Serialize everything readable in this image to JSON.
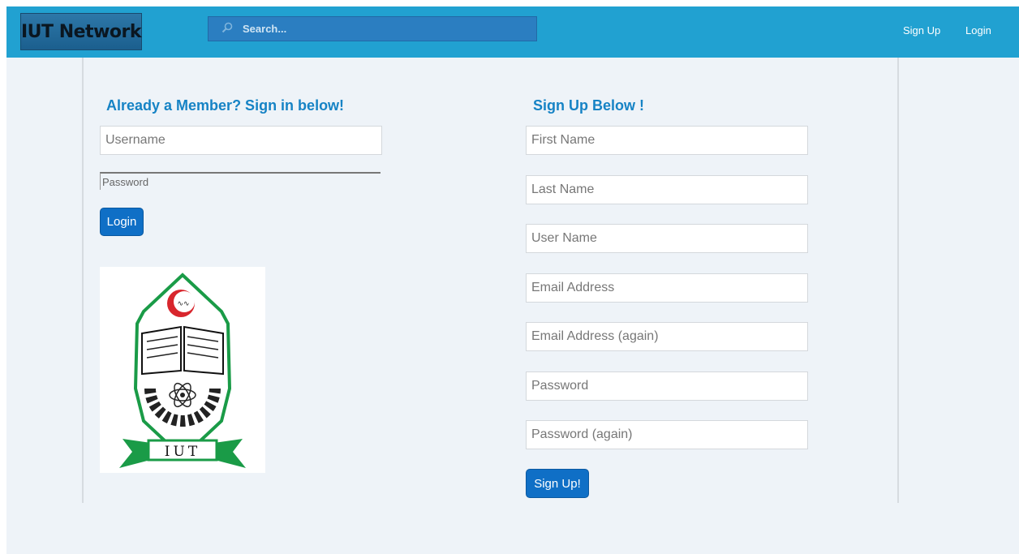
{
  "navbar": {
    "brand": "IUT Network",
    "search": {
      "placeholder": "Search..."
    },
    "links": {
      "signup": "Sign Up",
      "login": "Login"
    }
  },
  "login_form": {
    "heading": "Already a Member? Sign in below!",
    "username_placeholder": "Username",
    "password_placeholder": "Password",
    "login_button": "Login"
  },
  "logo": {
    "text": "IUT"
  },
  "signup_form": {
    "heading": "Sign Up Below !",
    "fields": {
      "first_name": "First Name",
      "last_name": "Last Name",
      "user_name": "User Name",
      "email": "Email Address",
      "email_again": "Email Address (again)",
      "password": "Password",
      "password_again": "Password (again)"
    },
    "signup_button": "Sign Up!"
  },
  "colors": {
    "navbar": "#21a1d1",
    "heading": "#1683c5",
    "button": "#0f6fc6",
    "page_bg": "#eef3f8"
  }
}
